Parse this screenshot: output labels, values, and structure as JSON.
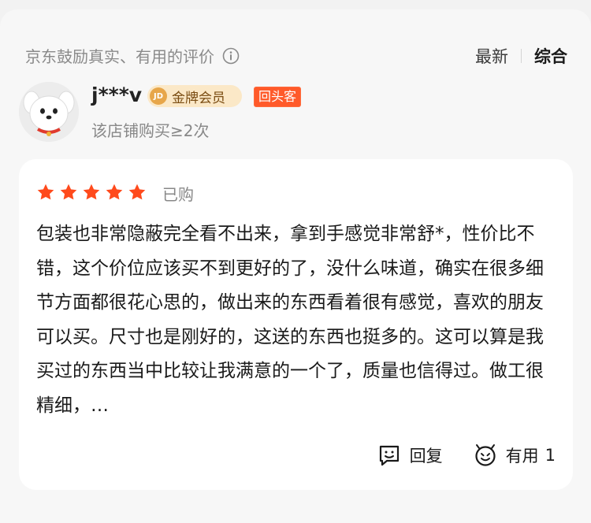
{
  "header": {
    "note": "京东鼓励真实、有用的评价",
    "sort_latest": "最新",
    "sort_overall": "综合"
  },
  "user": {
    "name": "j***v",
    "member_badge": "金牌会员",
    "jd_logo": "JD",
    "returning_badge": "回头客",
    "purchase_info": "该店铺购买≥2次"
  },
  "review": {
    "rating": 5,
    "status": "已购",
    "text": "包装也非常隐蔽完全看不出来，拿到手感觉非常舒*，性价比不错，这个价位应该买不到更好的了，没什么味道，确实在很多细节方面都很花心思的，做出来的东西看着很有感觉，喜欢的朋友可以买。尺寸也是刚好的，这送的东西也挺多的。这可以算是我买过的东西当中比较让我满意的一个了，质量也信得过。做工很精细，…"
  },
  "actions": {
    "reply_label": "回复",
    "useful_label": "有用",
    "useful_count": "1"
  },
  "colors": {
    "star": "#ff4a1c",
    "badge_bg": "#fbe8c7",
    "returning": "#ff5a2a"
  },
  "icons": [
    "info-icon",
    "jd-dog-avatar",
    "star-icon",
    "reply-icon",
    "useful-icon"
  ]
}
